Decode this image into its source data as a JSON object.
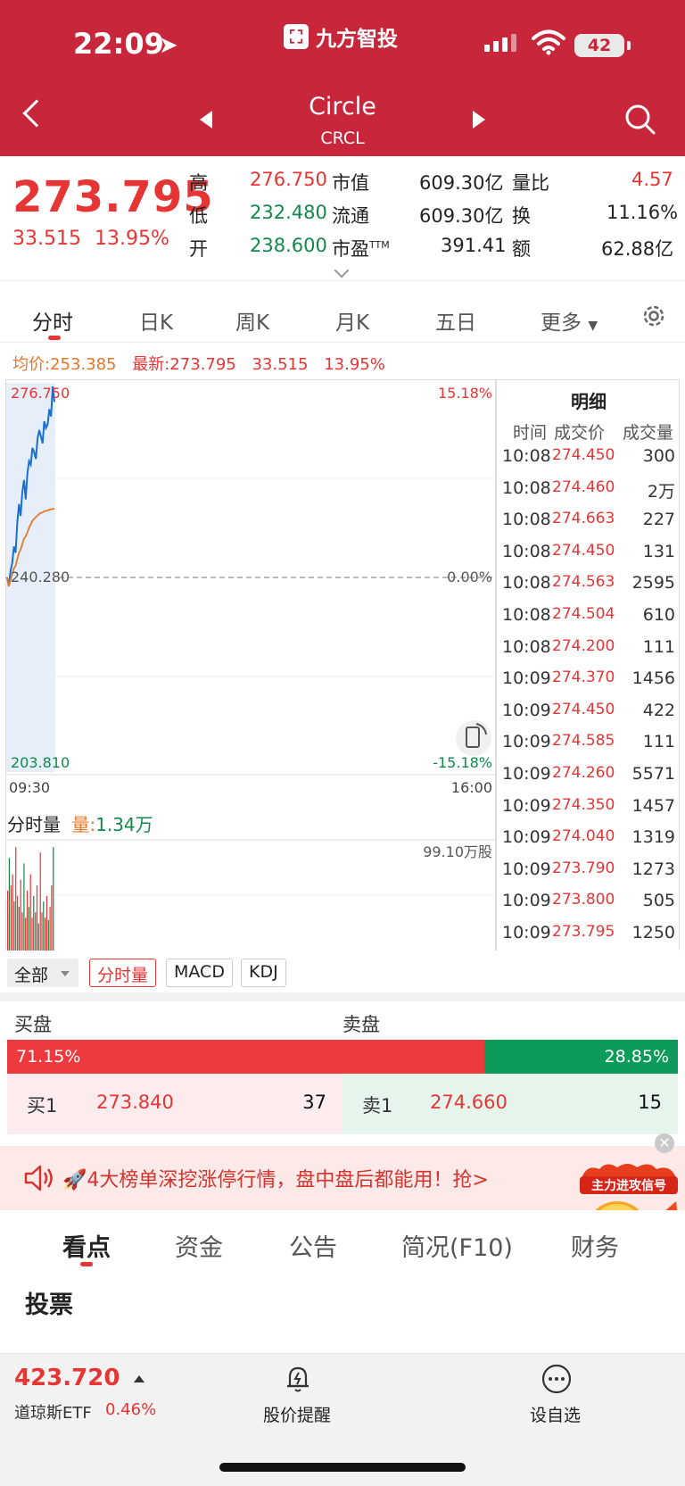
{
  "status_bar": {
    "time": "22:09",
    "battery": "42"
  },
  "brand": {
    "name": "九方智投"
  },
  "nav": {
    "stock_name": "Circle",
    "stock_code": "CRCL"
  },
  "quote": {
    "price": "273.795",
    "change": "33.515",
    "change_pct": "13.95%",
    "high_label": "高",
    "high": "276.750",
    "low_label": "低",
    "low": "232.480",
    "open_label": "开",
    "open": "238.600",
    "mcap_label": "市值",
    "mcap": "609.30亿",
    "float_label": "流通",
    "float": "609.30亿",
    "pe_label": "市盈",
    "pe_sup": "TTM",
    "pe": "391.41",
    "vr_label": "量比",
    "vr": "4.57",
    "turn_label": "换",
    "turn": "11.16%",
    "amt_label": "额",
    "amt": "62.88亿"
  },
  "chart_tabs": [
    "分时",
    "日K",
    "周K",
    "月K",
    "五日",
    "更多"
  ],
  "avg_bar": {
    "avg": "均价:253.385",
    "latest": "最新:273.795",
    "change": "33.515",
    "change_pct": "13.95%"
  },
  "chart_data": {
    "type": "line",
    "y_top": "276.750",
    "y_mid": "240.280",
    "y_bot": "203.810",
    "pct_top": "15.18%",
    "pct_mid": "0.00%",
    "pct_bot": "-15.18%",
    "x_start": "09:30",
    "x_end": "16:00",
    "ylim": [
      203.81,
      276.75
    ],
    "series": [
      {
        "values": [
          240.28,
          238.6,
          241.5,
          243.0,
          246.2,
          245.0,
          250.8,
          254.3,
          252.0,
          256.5,
          258.9,
          255.2,
          260.1,
          262.5,
          261.8,
          265.0,
          264.2,
          262.9,
          266.8,
          268.4,
          267.2,
          265.9,
          270.1,
          268.8,
          269.5,
          272.4,
          271.0,
          276.75,
          273.795
        ]
      },
      {
        "values": [
          240.28,
          238.6,
          239.8,
          240.9,
          242.0,
          242.5,
          243.8,
          245.0,
          245.6,
          246.6,
          247.7,
          248.1,
          248.9,
          249.8,
          250.4,
          251.1,
          251.5,
          251.8,
          252.1,
          252.4,
          252.6,
          252.7,
          252.9,
          253.0,
          253.1,
          253.2,
          253.3,
          253.35,
          253.385
        ]
      }
    ]
  },
  "volume": {
    "label": "分时量",
    "vol_label": "量:",
    "vol": "1.34万",
    "max": "99.10万股",
    "bars": [
      0.55,
      0.85,
      0.6,
      0.7,
      0.45,
      0.95,
      0.5,
      0.4,
      0.65,
      0.35,
      0.8,
      0.3,
      0.55,
      0.4,
      0.7,
      0.3,
      0.5,
      0.35,
      0.6,
      0.25,
      0.9,
      0.35,
      0.45,
      0.3,
      0.5,
      0.28,
      0.4,
      0.6,
      0.95
    ]
  },
  "detail": {
    "title": "明细",
    "h_time": "时间",
    "h_price": "成交价",
    "h_vol": "成交量",
    "rows": [
      {
        "t": "10:08",
        "p": "274.450",
        "v": "300"
      },
      {
        "t": "10:08",
        "p": "274.460",
        "v": "2万"
      },
      {
        "t": "10:08",
        "p": "274.663",
        "v": "227"
      },
      {
        "t": "10:08",
        "p": "274.450",
        "v": "131"
      },
      {
        "t": "10:08",
        "p": "274.563",
        "v": "2595"
      },
      {
        "t": "10:08",
        "p": "274.504",
        "v": "610"
      },
      {
        "t": "10:08",
        "p": "274.200",
        "v": "111"
      },
      {
        "t": "10:09",
        "p": "274.370",
        "v": "1456"
      },
      {
        "t": "10:09",
        "p": "274.450",
        "v": "422"
      },
      {
        "t": "10:09",
        "p": "274.585",
        "v": "111"
      },
      {
        "t": "10:09",
        "p": "274.260",
        "v": "5571"
      },
      {
        "t": "10:09",
        "p": "274.350",
        "v": "1457"
      },
      {
        "t": "10:09",
        "p": "274.040",
        "v": "1319"
      },
      {
        "t": "10:09",
        "p": "273.790",
        "v": "1273"
      },
      {
        "t": "10:09",
        "p": "273.800",
        "v": "505"
      },
      {
        "t": "10:09",
        "p": "273.795",
        "v": "1250"
      }
    ]
  },
  "indicators": {
    "all": "全部",
    "i1": "分时量",
    "i2": "MACD",
    "i3": "KDJ"
  },
  "order_book": {
    "buy_label": "买盘",
    "sell_label": "卖盘",
    "buy_pct": "71.15%",
    "sell_pct": "28.85%",
    "buy_ratio": 0.7115,
    "b1_label": "买1",
    "b1_price": "273.840",
    "b1_vol": "37",
    "s1_label": "卖1",
    "s1_price": "274.660",
    "s1_vol": "15"
  },
  "banner": {
    "text": "🚀4大榜单深挖涨停行情，盘中盘后都能用！抢>",
    "promo": "主力进攻信号"
  },
  "news_tabs": [
    "看点",
    "资金",
    "公告",
    "简况(F10)",
    "财务"
  ],
  "section": {
    "vote": "投票"
  },
  "bottom": {
    "etf_price": "423.720",
    "etf_name": "道琼斯ETF",
    "etf_change": "0.46%",
    "alert": "股价提醒",
    "watch": "设自选"
  },
  "colors": {
    "brand": "#c8263a",
    "up": "#e63535",
    "down": "#10894a",
    "avg_line": "#e8762a",
    "price_line": "#1a6fd1"
  }
}
